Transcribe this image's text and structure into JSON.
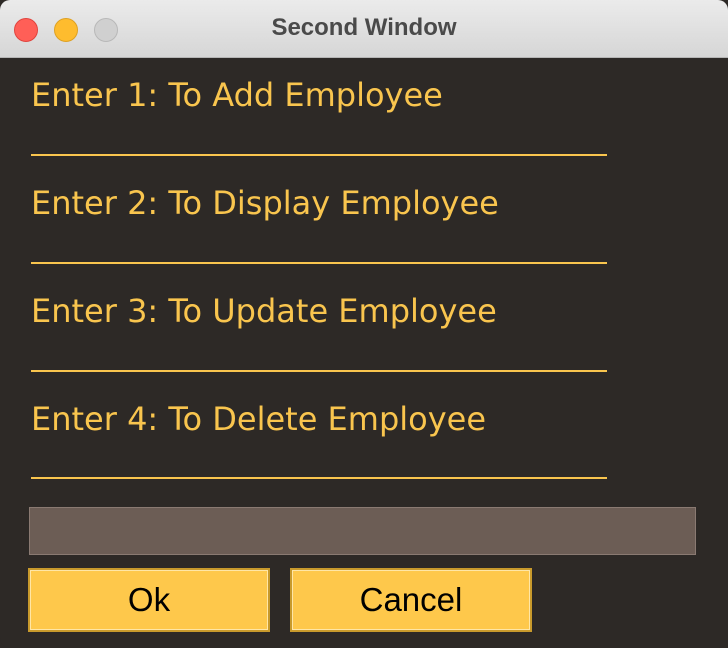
{
  "window": {
    "title": "Second Window"
  },
  "menu": {
    "items": [
      {
        "label": "Enter 1: To Add Employee",
        "separator": "________________________________"
      },
      {
        "label": "Enter 2: To Display Employee",
        "separator": "________________________________"
      },
      {
        "label": "Enter 3: To Update Employee",
        "separator": "________________________________"
      },
      {
        "label": "Enter 4: To Delete Employee",
        "separator": "________________________________"
      }
    ]
  },
  "entry": {
    "value": ""
  },
  "buttons": {
    "ok_label": "Ok",
    "cancel_label": "Cancel"
  },
  "colors": {
    "background": "#2d2926",
    "text_accent": "#f9c54e",
    "entry_background": "#6c5d55",
    "button_background": "#fec84b"
  },
  "icons": {
    "close": "close-icon",
    "minimize": "minimize-icon",
    "zoom": "zoom-icon"
  }
}
